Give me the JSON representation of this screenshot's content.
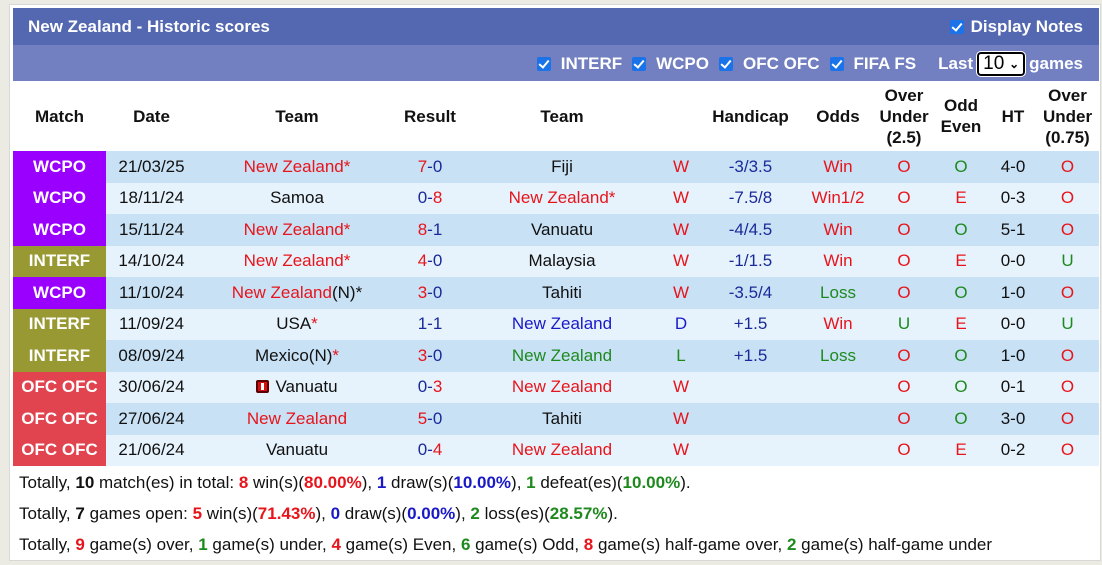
{
  "header": {
    "title": "New Zealand - Historic scores",
    "display_notes_label": "Display Notes",
    "display_notes_checked": true
  },
  "filters": {
    "items": [
      {
        "label": "INTERF",
        "checked": true
      },
      {
        "label": "WCPO",
        "checked": true
      },
      {
        "label": "OFC OFC",
        "checked": true
      },
      {
        "label": "FIFA FS",
        "checked": true
      }
    ],
    "last_label": "Last",
    "last_value": "10",
    "games_label": "games"
  },
  "colors": {
    "WCPO": "#9a00fe",
    "INTERF": "#999933",
    "OFC OFC": "#e1434f",
    "title_bar": "#5468b1",
    "filter_bar": "#7280c1"
  },
  "table": {
    "headers": [
      "Match",
      "Date",
      "Team",
      "Result",
      "Team",
      "",
      "Handicap",
      "Odds",
      "Over Under (2.5)",
      "Odd Even",
      "HT",
      "Over Under (0.75)"
    ],
    "rows": [
      {
        "match": "WCPO",
        "date": "21/03/25",
        "home": "New Zealand",
        "home_suffix": "*",
        "home_color": "red",
        "home_flag": false,
        "result_home": "7",
        "result_away": "0",
        "away": "Fiji",
        "away_color": "black",
        "wdl": "W",
        "handicap": "-3/3.5",
        "odds": "Win",
        "ou": "O",
        "oe": "O",
        "ht": "4-0",
        "ou2": "O"
      },
      {
        "match": "WCPO",
        "date": "18/11/24",
        "home": "Samoa",
        "home_suffix": "",
        "home_color": "black",
        "home_flag": false,
        "result_home": "0",
        "result_away": "8",
        "away": "New Zealand*",
        "away_color": "red",
        "wdl": "W",
        "handicap": "-7.5/8",
        "odds": "Win1/2",
        "ou": "O",
        "oe": "E",
        "ht": "0-3",
        "ou2": "O"
      },
      {
        "match": "WCPO",
        "date": "15/11/24",
        "home": "New Zealand",
        "home_suffix": "*",
        "home_color": "red",
        "home_flag": false,
        "result_home": "8",
        "result_away": "1",
        "away": "Vanuatu",
        "away_color": "black",
        "wdl": "W",
        "handicap": "-4/4.5",
        "odds": "Win",
        "ou": "O",
        "oe": "O",
        "ht": "5-1",
        "ou2": "O"
      },
      {
        "match": "INTERF",
        "date": "14/10/24",
        "home": "New Zealand",
        "home_suffix": "*",
        "home_color": "red",
        "home_flag": false,
        "result_home": "4",
        "result_away": "0",
        "away": "Malaysia",
        "away_color": "black",
        "wdl": "W",
        "handicap": "-1/1.5",
        "odds": "Win",
        "ou": "O",
        "oe": "E",
        "ht": "0-0",
        "ou2": "U"
      },
      {
        "match": "WCPO",
        "date": "11/10/24",
        "home": "New Zealand",
        "home_suffix": "(N)*",
        "home_color": "red",
        "home_flag": false,
        "result_home": "3",
        "result_away": "0",
        "away": "Tahiti",
        "away_color": "black",
        "wdl": "W",
        "handicap": "-3.5/4",
        "odds": "Loss",
        "ou": "O",
        "oe": "O",
        "ht": "1-0",
        "ou2": "O"
      },
      {
        "match": "INTERF",
        "date": "11/09/24",
        "home": "USA",
        "home_suffix": "*",
        "home_color": "black",
        "home_flag": false,
        "result_home": "1",
        "result_away": "1",
        "away": "New Zealand",
        "away_color": "blue",
        "wdl": "D",
        "handicap": "+1.5",
        "odds": "Win",
        "ou": "U",
        "oe": "E",
        "ht": "0-0",
        "ou2": "U"
      },
      {
        "match": "INTERF",
        "date": "08/09/24",
        "home": "Mexico(N)",
        "home_suffix": "*",
        "home_color": "black",
        "home_flag": false,
        "result_home": "3",
        "result_away": "0",
        "away": "New Zealand",
        "away_color": "green",
        "wdl": "L",
        "handicap": "+1.5",
        "odds": "Loss",
        "ou": "O",
        "oe": "O",
        "ht": "1-0",
        "ou2": "O"
      },
      {
        "match": "OFC OFC",
        "date": "30/06/24",
        "home": "Vanuatu",
        "home_suffix": "",
        "home_color": "black",
        "home_flag": true,
        "result_home": "0",
        "result_away": "3",
        "away": "New Zealand",
        "away_color": "red",
        "wdl": "W",
        "handicap": "",
        "odds": "",
        "ou": "O",
        "oe": "O",
        "ht": "0-1",
        "ou2": "O"
      },
      {
        "match": "OFC OFC",
        "date": "27/06/24",
        "home": "New Zealand",
        "home_suffix": "",
        "home_color": "red",
        "home_flag": false,
        "result_home": "5",
        "result_away": "0",
        "away": "Tahiti",
        "away_color": "black",
        "wdl": "W",
        "handicap": "",
        "odds": "",
        "ou": "O",
        "oe": "O",
        "ht": "3-0",
        "ou2": "O"
      },
      {
        "match": "OFC OFC",
        "date": "21/06/24",
        "home": "Vanuatu",
        "home_suffix": "",
        "home_color": "black",
        "home_flag": false,
        "result_home": "0",
        "result_away": "4",
        "away": "New Zealand",
        "away_color": "red",
        "wdl": "W",
        "handicap": "",
        "odds": "",
        "ou": "O",
        "oe": "E",
        "ht": "0-2",
        "ou2": "O"
      }
    ]
  },
  "summary": {
    "line1": [
      {
        "t": "Totally, "
      },
      {
        "t": "10",
        "c": "black",
        "b": true
      },
      {
        "t": " match(es) in total: "
      },
      {
        "t": "8",
        "c": "red",
        "b": true
      },
      {
        "t": " win(s)("
      },
      {
        "t": "80.00%",
        "c": "red",
        "b": true
      },
      {
        "t": "), "
      },
      {
        "t": "1",
        "c": "blue",
        "b": true
      },
      {
        "t": " draw(s)("
      },
      {
        "t": "10.00%",
        "c": "blue",
        "b": true
      },
      {
        "t": "), "
      },
      {
        "t": "1",
        "c": "green",
        "b": true
      },
      {
        "t": " defeat(es)("
      },
      {
        "t": "10.00%",
        "c": "green",
        "b": true
      },
      {
        "t": ")."
      }
    ],
    "line2": [
      {
        "t": "Totally, "
      },
      {
        "t": "7",
        "c": "black",
        "b": true
      },
      {
        "t": " games open: "
      },
      {
        "t": "5",
        "c": "red",
        "b": true
      },
      {
        "t": " win(s)("
      },
      {
        "t": "71.43%",
        "c": "red",
        "b": true
      },
      {
        "t": "), "
      },
      {
        "t": "0",
        "c": "blue",
        "b": true
      },
      {
        "t": " draw(s)("
      },
      {
        "t": "0.00%",
        "c": "blue",
        "b": true
      },
      {
        "t": "), "
      },
      {
        "t": "2",
        "c": "green",
        "b": true
      },
      {
        "t": " loss(es)("
      },
      {
        "t": "28.57%",
        "c": "green",
        "b": true
      },
      {
        "t": ")."
      }
    ],
    "line3": [
      {
        "t": "Totally, "
      },
      {
        "t": "9",
        "c": "red",
        "b": true
      },
      {
        "t": " game(s) over, "
      },
      {
        "t": "1",
        "c": "green",
        "b": true
      },
      {
        "t": " game(s) under, "
      },
      {
        "t": "4",
        "c": "red",
        "b": true
      },
      {
        "t": " game(s) Even, "
      },
      {
        "t": "6",
        "c": "green",
        "b": true
      },
      {
        "t": " game(s) Odd, "
      },
      {
        "t": "8",
        "c": "red",
        "b": true
      },
      {
        "t": " game(s) half-game over, "
      },
      {
        "t": "2",
        "c": "green",
        "b": true
      },
      {
        "t": " game(s) half-game under"
      }
    ]
  }
}
